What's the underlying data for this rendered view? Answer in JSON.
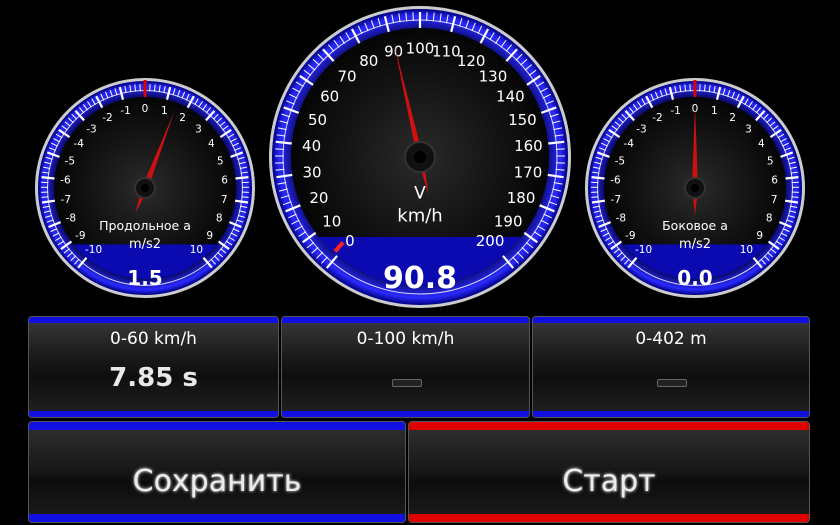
{
  "colors": {
    "accent_blue": "#1010e0",
    "accent_red": "#e00000",
    "needle": "#d01010"
  },
  "gauges": [
    {
      "id": "longitudinal",
      "label1": "Продольное а",
      "label2": "m/s2",
      "value": "1.5",
      "min": -10,
      "max": 10,
      "reading": 1.5,
      "tick_labels": [
        "-10",
        "-9",
        "-8",
        "-7",
        "-6",
        "-5",
        "-4",
        "-3",
        "-2",
        "-1",
        "0",
        "1",
        "2",
        "3",
        "4",
        "5",
        "6",
        "7",
        "8",
        "9",
        "10"
      ]
    },
    {
      "id": "speed",
      "label1": "V",
      "label2": "km/h",
      "value": "90.8",
      "min": 0,
      "max": 200,
      "reading": 90.8,
      "tick_labels": [
        "0",
        "10",
        "20",
        "30",
        "40",
        "50",
        "60",
        "70",
        "80",
        "90",
        "100",
        "110",
        "120",
        "130",
        "140",
        "150",
        "160",
        "170",
        "180",
        "190",
        "200"
      ]
    },
    {
      "id": "lateral",
      "label1": "Боковое а",
      "label2": "m/s2",
      "value": "0.0",
      "min": -10,
      "max": 10,
      "reading": 0.0,
      "tick_labels": [
        "-10",
        "-9",
        "-8",
        "-7",
        "-6",
        "-5",
        "-4",
        "-3",
        "-2",
        "-1",
        "0",
        "1",
        "2",
        "3",
        "4",
        "5",
        "6",
        "7",
        "8",
        "9",
        "10"
      ]
    }
  ],
  "panels": [
    {
      "title": "0-60 km/h",
      "value": "7.85 s",
      "has_value": true
    },
    {
      "title": "0-100 km/h",
      "value": "",
      "has_value": false
    },
    {
      "title": "0-402 m",
      "value": "",
      "has_value": false
    }
  ],
  "buttons": {
    "save_label": "Сохранить",
    "start_label": "Старт"
  }
}
